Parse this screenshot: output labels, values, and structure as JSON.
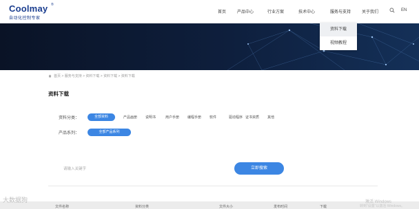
{
  "header": {
    "logo_text": "Coolmay",
    "logo_reg": "®",
    "logo_sub": "自动化控制专家",
    "nav": [
      "首页",
      "产品中心",
      "行业方案",
      "技术中心",
      "服务与支持",
      "关于我们"
    ],
    "lang": "EN"
  },
  "dropdown": {
    "items": [
      "资料下载",
      "视频教程"
    ]
  },
  "breadcrumb": "首页 > 服务与支持 > 资料下载 > 资料下载 > 资料下载",
  "page_title": "资料下载",
  "filters": {
    "category_label": "资料分类：",
    "category_selected": "全部资料",
    "category_options": [
      "产品画册",
      "说明书",
      "用户手册",
      "编程手册",
      "软件",
      "驱动程序",
      "证书资质",
      "其他"
    ],
    "series_label": "产品系列：",
    "series_selected": "全部产品系列"
  },
  "search": {
    "placeholder": "请输入关键字",
    "button": "立即搜索"
  },
  "table": {
    "headers": [
      "文件名称",
      "资料分类",
      "文件大小",
      "发布时间",
      "下载"
    ]
  },
  "watermark": "大数据狗",
  "windows": {
    "title": "激活 Windows",
    "sub": "转到“设置”以激活 Windows。"
  }
}
